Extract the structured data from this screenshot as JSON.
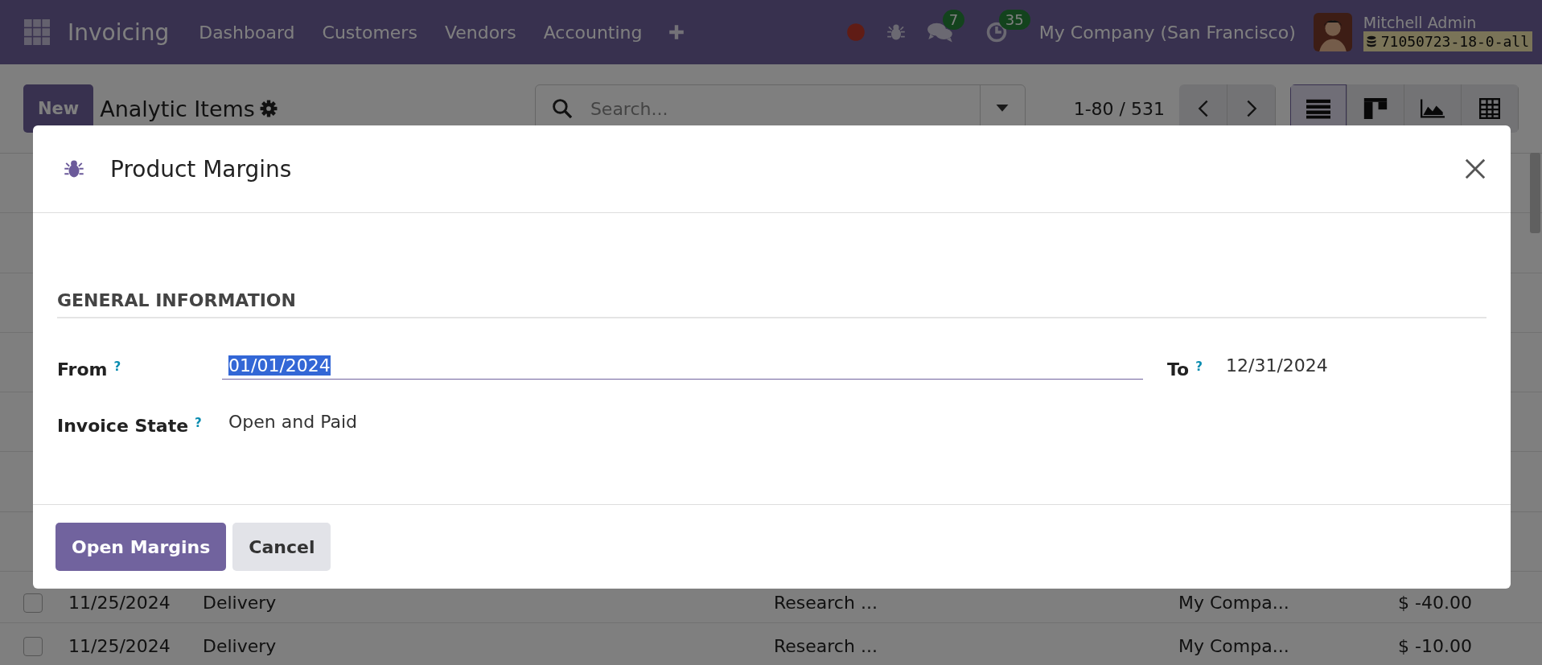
{
  "navbar": {
    "app_name": "Invoicing",
    "menu": [
      "Dashboard",
      "Customers",
      "Vendors",
      "Accounting"
    ],
    "messages_badge": "7",
    "activities_badge": "35",
    "company": "My Company (San Francisco)",
    "user": "Mitchell Admin",
    "database": "71050723-18-0-all"
  },
  "control_panel": {
    "new_button": "New",
    "title": "Analytic Items",
    "search": {
      "placeholder": "Search..."
    },
    "pager": "1-80 / 531",
    "views": [
      {
        "kind": "list",
        "selected": true
      },
      {
        "kind": "kanban",
        "selected": false
      },
      {
        "kind": "graph",
        "selected": false
      },
      {
        "kind": "pivot",
        "selected": false
      }
    ]
  },
  "list": {
    "rows": [
      {
        "checked": false,
        "date": "11/25/2024",
        "name": "Delivery",
        "account": "Research ...",
        "company": "My Compa...",
        "amount": "$ -40.00"
      },
      {
        "checked": false,
        "date": "11/25/2024",
        "name": "Delivery",
        "account": "Research ...",
        "company": "My Compa...",
        "amount": "$ -10.00"
      }
    ]
  },
  "dialog": {
    "title": "Product Margins",
    "section": "GENERAL INFORMATION",
    "from": {
      "label": "From",
      "help": "?",
      "value": "01/01/2024",
      "focused": true
    },
    "to": {
      "label": "To",
      "help": "?",
      "value": "12/31/2024",
      "focused": false
    },
    "invoice_state": {
      "label": "Invoice State",
      "help": "?",
      "value": "Open and Paid",
      "focused": false
    },
    "buttons": [
      {
        "label": "Open Margins",
        "kind": "primary"
      },
      {
        "label": "Cancel",
        "kind": "secondary"
      }
    ]
  }
}
